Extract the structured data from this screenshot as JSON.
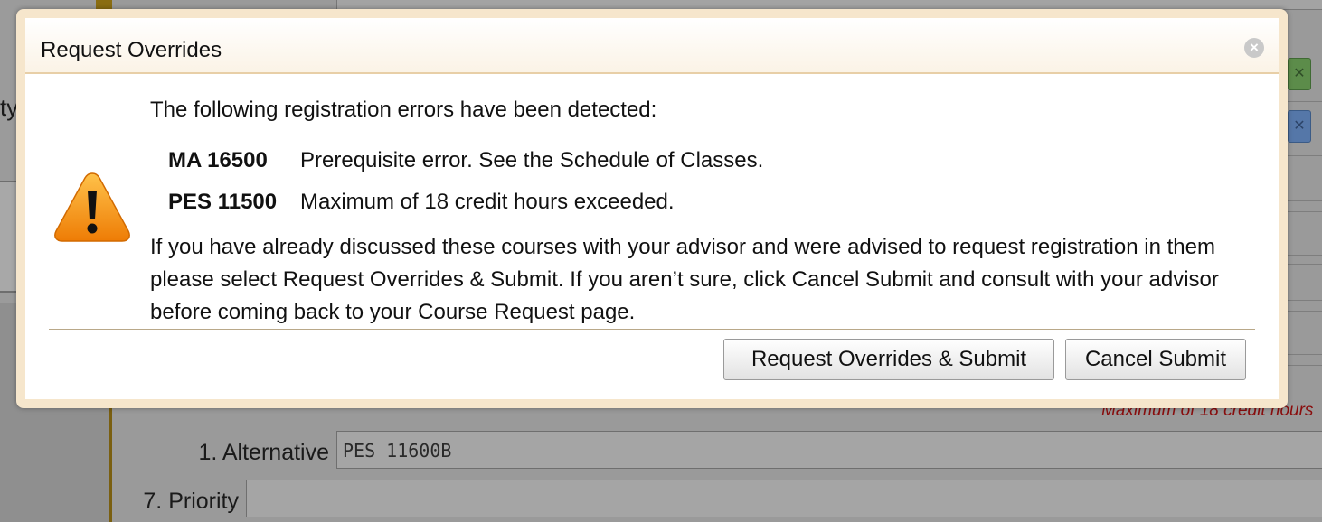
{
  "background": {
    "partial_label": "ty",
    "remove_icon_green": "✕",
    "remove_icon_blue": "✕",
    "note": "Maximum of 18 credit hours",
    "rows": [
      {
        "label": "1. Alternative",
        "value": "PES 11600B"
      },
      {
        "label": "7. Priority",
        "value": ""
      }
    ]
  },
  "dialog": {
    "title": "Request Overrides",
    "close_icon": "×",
    "warning_icon": "warning-triangle",
    "intro": "The following registration errors have been detected:",
    "errors": [
      {
        "course": "MA 16500",
        "message": "Prerequisite error. See the Schedule of Classes."
      },
      {
        "course": "PES 11500",
        "message": "Maximum of 18 credit hours exceeded."
      }
    ],
    "advice": "If you have already discussed these courses with your advisor and were advised to request registration in them please select Request Overrides & Submit. If you aren’t sure, click Cancel Submit and consult with your advisor before coming back to your Course Request page.",
    "buttons": {
      "submit_label": "Request Overrides & Submit",
      "cancel_label": "Cancel Submit"
    }
  },
  "colors": {
    "overlay": "#8f8f8f",
    "dialog_border": "#f6e6cc",
    "warning_orange": "#f39a14",
    "note_red": "#8a0d0d"
  }
}
